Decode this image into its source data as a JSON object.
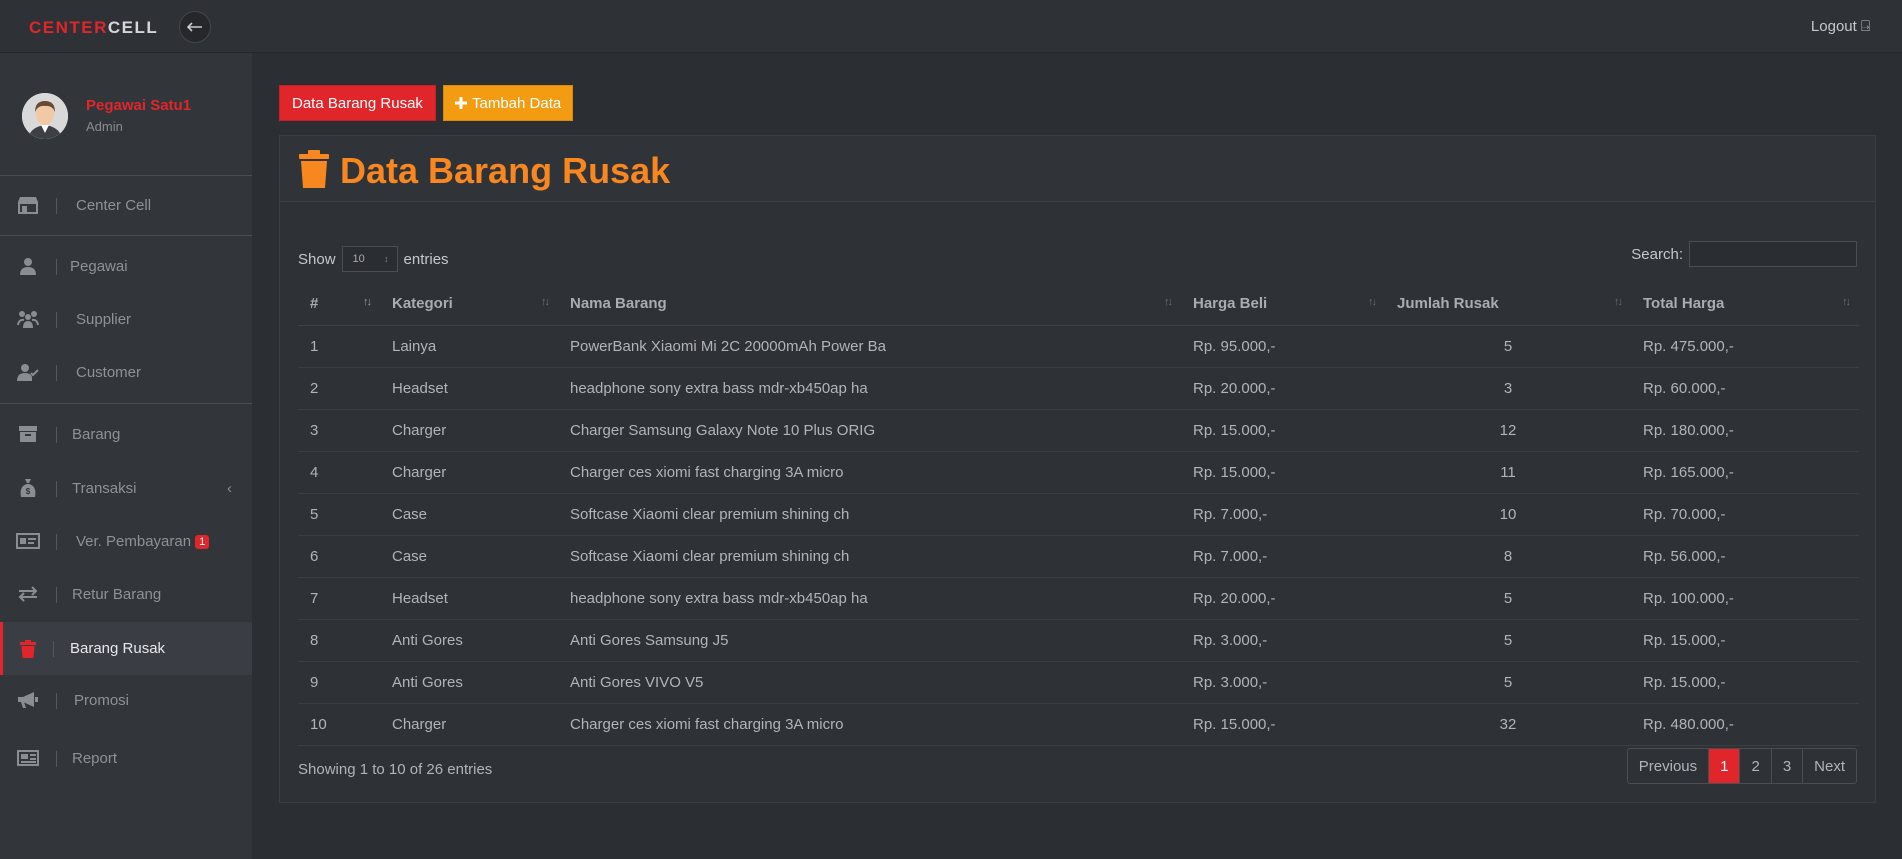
{
  "app": {
    "brand_a": "CENTER",
    "brand_b": "CELL",
    "logout": "Logout"
  },
  "profile": {
    "name": "Pegawai Satu1",
    "role": "Admin"
  },
  "sidebar": {
    "items": [
      {
        "label": "Center Cell",
        "icon": "store-icon"
      },
      {
        "label": "Pegawai",
        "icon": "user-icon"
      },
      {
        "label": "Supplier",
        "icon": "users-icon"
      },
      {
        "label": "Customer",
        "icon": "user-check-icon"
      },
      {
        "label": "Barang",
        "icon": "archive-icon"
      },
      {
        "label": "Transaksi",
        "icon": "money-bag-icon"
      },
      {
        "label": "Ver. Pembayaran",
        "icon": "money-bill-icon",
        "badge": "1"
      },
      {
        "label": "Retur Barang",
        "icon": "exchange-icon"
      },
      {
        "label": "Barang Rusak",
        "icon": "trash-icon"
      },
      {
        "label": "Promosi",
        "icon": "megaphone-icon"
      },
      {
        "label": "Report",
        "icon": "report-icon"
      }
    ]
  },
  "buttons": {
    "data_barang_rusak": "Data Barang Rusak",
    "tambah_data": "Tambah Data"
  },
  "panel": {
    "title": "Data Barang Rusak"
  },
  "controls": {
    "show": "Show",
    "entries_value": "10",
    "entries": "entries",
    "search": "Search:"
  },
  "table": {
    "headers": [
      "#",
      "Kategori",
      "Nama Barang",
      "Harga Beli",
      "Jumlah Rusak",
      "Total Harga"
    ],
    "rows": [
      [
        "1",
        "Lainya",
        "PowerBank Xiaomi Mi 2C 20000mAh Power Ba",
        "Rp. 95.000,-",
        "5",
        "Rp. 475.000,-"
      ],
      [
        "2",
        "Headset",
        "headphone sony extra bass mdr-xb450ap ha",
        "Rp. 20.000,-",
        "3",
        "Rp. 60.000,-"
      ],
      [
        "3",
        "Charger",
        "Charger Samsung Galaxy Note 10 Plus ORIG",
        "Rp. 15.000,-",
        "12",
        "Rp. 180.000,-"
      ],
      [
        "4",
        "Charger",
        "Charger ces xiomi fast charging 3A micro",
        "Rp. 15.000,-",
        "11",
        "Rp. 165.000,-"
      ],
      [
        "5",
        "Case",
        "Softcase Xiaomi clear premium shining ch",
        "Rp. 7.000,-",
        "10",
        "Rp. 70.000,-"
      ],
      [
        "6",
        "Case",
        "Softcase Xiaomi clear premium shining ch",
        "Rp. 7.000,-",
        "8",
        "Rp. 56.000,-"
      ],
      [
        "7",
        "Headset",
        "headphone sony extra bass mdr-xb450ap ha",
        "Rp. 20.000,-",
        "5",
        "Rp. 100.000,-"
      ],
      [
        "8",
        "Anti Gores",
        "Anti Gores Samsung J5",
        "Rp. 3.000,-",
        "5",
        "Rp. 15.000,-"
      ],
      [
        "9",
        "Anti Gores",
        "Anti Gores VIVO V5",
        "Rp. 3.000,-",
        "5",
        "Rp. 15.000,-"
      ],
      [
        "10",
        "Charger",
        "Charger ces xiomi fast charging 3A micro",
        "Rp. 15.000,-",
        "32",
        "Rp. 480.000,-"
      ]
    ]
  },
  "footer": {
    "showing": "Showing 1 to 10 of 26 entries"
  },
  "pagination": {
    "previous": "Previous",
    "pages": [
      "1",
      "2",
      "3"
    ],
    "next": "Next"
  },
  "colors": {
    "accent_red": "#e0262b",
    "accent_orange": "#f39c12",
    "title_orange": "#f98720"
  }
}
